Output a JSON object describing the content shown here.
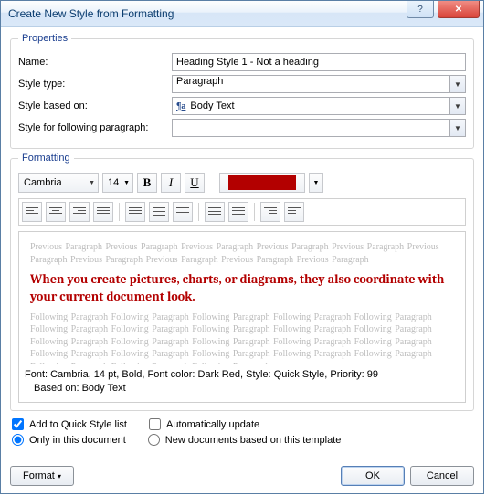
{
  "window": {
    "title": "Create New Style from Formatting"
  },
  "properties": {
    "legend": "Properties",
    "name_label": "Name:",
    "name_value": "Heading Style 1 - Not a heading",
    "type_label": "Style type:",
    "type_value": "Paragraph",
    "based_label": "Style based on:",
    "based_value": "Body Text",
    "following_label": "Style for following paragraph:",
    "following_value": ""
  },
  "formatting": {
    "legend": "Formatting",
    "font_name": "Cambria",
    "font_size": "14",
    "bold": "B",
    "italic": "I",
    "underline": "U",
    "color_hex": "#b30000"
  },
  "preview": {
    "grey_before": "Previous Paragraph Previous Paragraph Previous Paragraph Previous Paragraph Previous Paragraph Previous Paragraph Previous Paragraph Previous Paragraph Previous Paragraph Previous Paragraph",
    "sample": "When you create pictures, charts, or diagrams, they also coordinate with your current document look.",
    "grey_after": "Following Paragraph Following Paragraph Following Paragraph Following Paragraph Following Paragraph Following Paragraph Following Paragraph Following Paragraph Following Paragraph Following Paragraph Following Paragraph Following Paragraph Following Paragraph Following Paragraph Following Paragraph Following Paragraph Following Paragraph Following Paragraph Following Paragraph Following Paragraph Following Paragraph Following Paragraph Following Paragraph"
  },
  "description": {
    "line1": "Font: Cambria, 14 pt, Bold, Font color: Dark Red, Style: Quick Style, Priority: 99",
    "line2": "Based on: Body Text"
  },
  "options": {
    "add_quick": "Add to Quick Style list",
    "auto_update": "Automatically update",
    "only_doc": "Only in this document",
    "new_docs": "New documents based on this template"
  },
  "buttons": {
    "format": "Format",
    "ok": "OK",
    "cancel": "Cancel"
  },
  "glyphs": {
    "help": "?",
    "close": "✕",
    "dropdown": "▼",
    "menu": "▾"
  }
}
